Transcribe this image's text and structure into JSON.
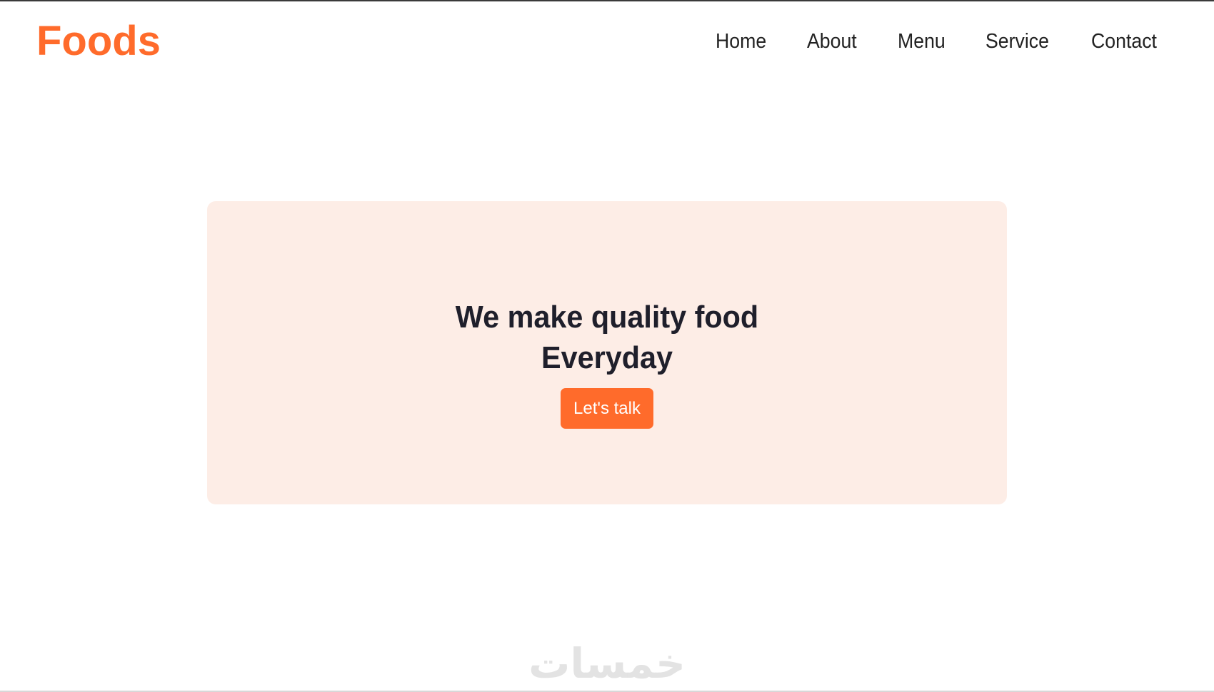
{
  "brand": {
    "logo_text": "Foods",
    "accent_color": "#ff6b2b"
  },
  "nav": {
    "items": [
      {
        "label": "Home"
      },
      {
        "label": "About"
      },
      {
        "label": "Menu"
      },
      {
        "label": "Service"
      },
      {
        "label": "Contact"
      }
    ]
  },
  "hero": {
    "title_line1": "We make quality food",
    "title_line2": "Everyday",
    "cta_label": "Let's talk",
    "background_color": "#fdede6"
  },
  "watermark": {
    "text": "خمسات"
  }
}
